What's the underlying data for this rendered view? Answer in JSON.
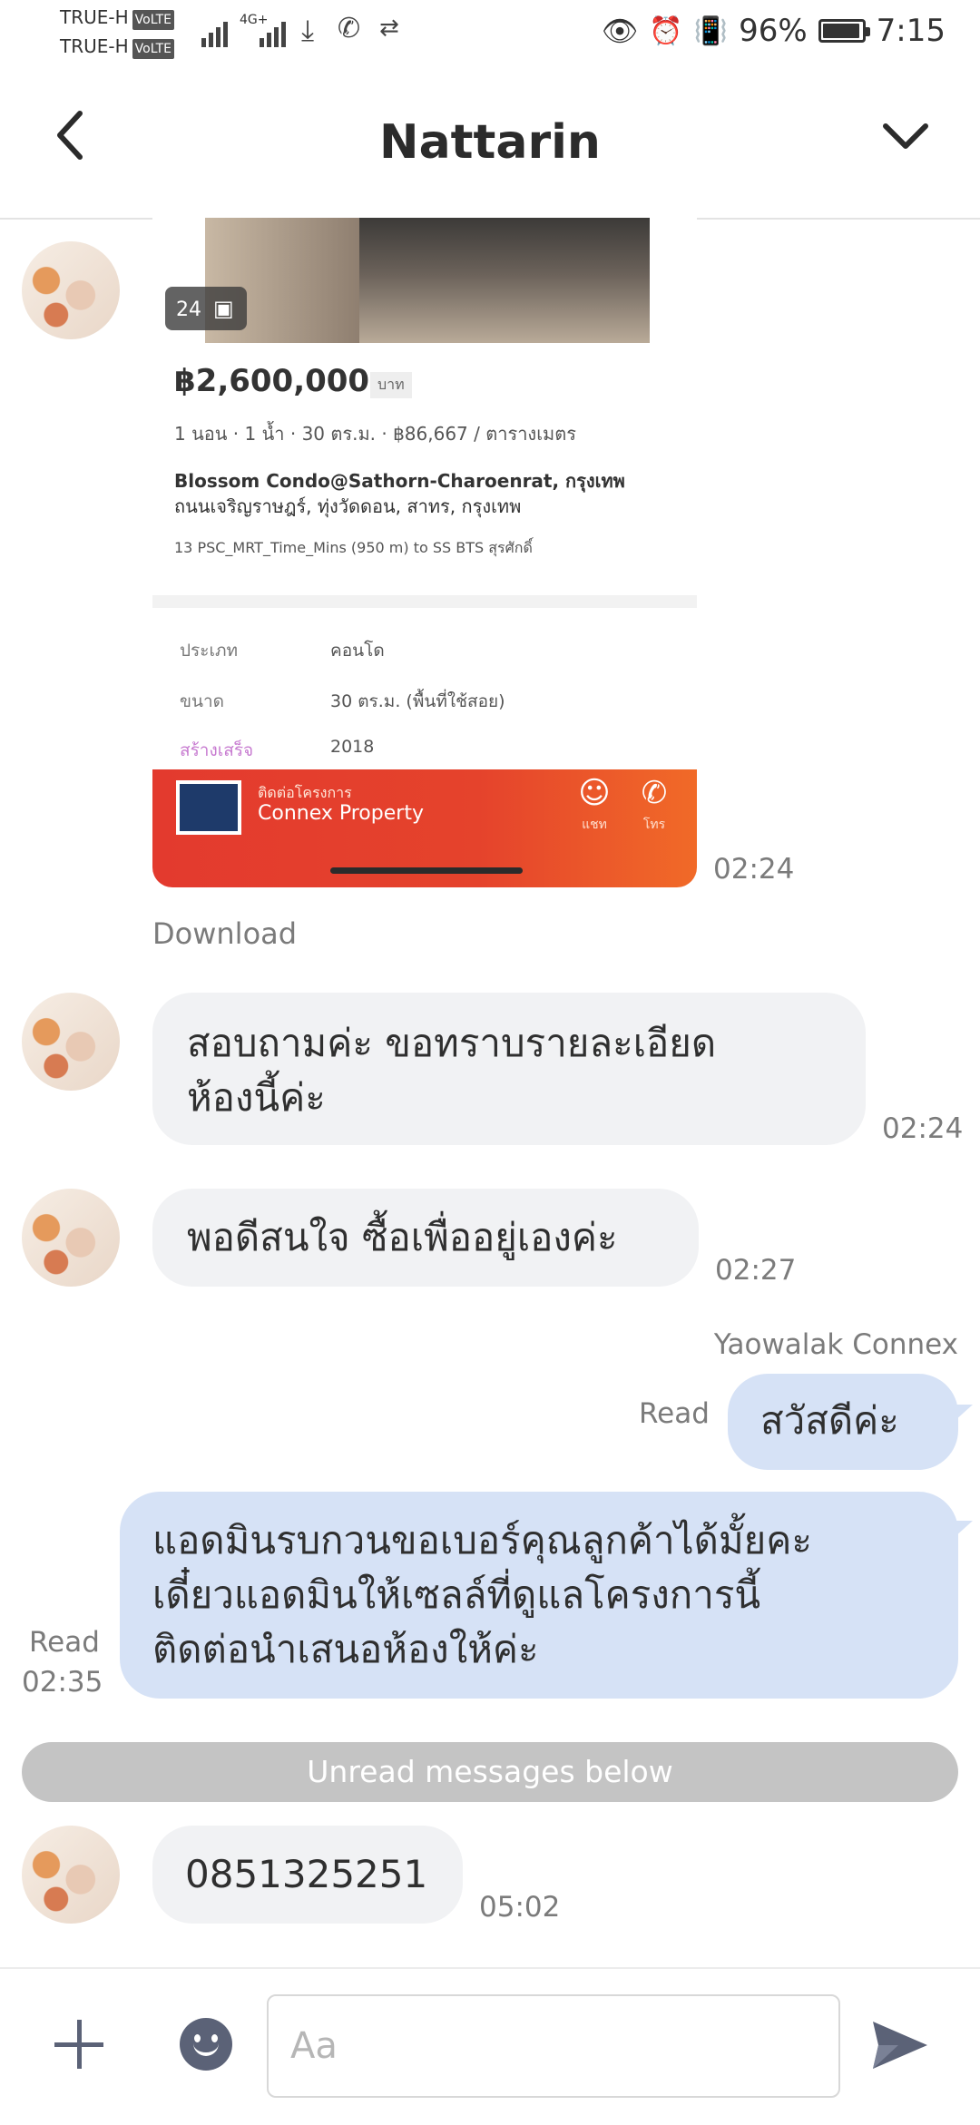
{
  "status_bar": {
    "carrier_1": "TRUE-H",
    "carrier_2": "TRUE-H",
    "volte": "VoLTE",
    "network": "4G+",
    "battery": "96%",
    "battery_level": 0.96,
    "time": "7:15"
  },
  "header": {
    "title": "Nattarin"
  },
  "card": {
    "photo_count": "24",
    "price": "฿2,600,000",
    "price_unit": "บาท",
    "specs": "1 นอน · 1 น้ำ · 30 ตร.ม. · ฿86,667 / ตารางเมตร",
    "address_1": "Blossom Condo@Sathorn-Charoenrat, กรุงเทพ",
    "address_2": "ถนนเจริญราษฎร์, ทุ่งวัดดอน, สาทร, กรุงเทพ",
    "transit": "13 PSC_MRT_Time_Mins (950 m) to SS BTS สุรศักดิ์",
    "details": [
      {
        "key": "ประเภท",
        "value": "คอนโด"
      },
      {
        "key": "ขนาด",
        "value": "30 ตร.ม. (พื้นที่ใช้สอย)"
      },
      {
        "key": "สร้างเสร็จ",
        "value": "2018"
      }
    ],
    "agent_label": "ติดต่อโครงการ",
    "agent_name": "Connex Property",
    "chat_label": "แชท",
    "call_label": "โทร"
  },
  "messages": {
    "image_time": "02:24",
    "download": "Download",
    "msg1_line1": "สอบถามค่ะ ขอทราบรายละเอียด",
    "msg1_line2": "ห้องนี้ค่ะ",
    "msg1_time": "02:24",
    "msg2": "พอดีสนใจ ซื้อเพื่ออยู่เองค่ะ",
    "msg2_time": "02:27",
    "sender": "Yaowalak Connex",
    "read_label": "Read",
    "msg3": "สวัสดีค่ะ",
    "msg4_line1": "แอดมินรบกวนขอเบอร์คุณลูกค้าได้มั้ยคะ",
    "msg4_line2": "เดี๋ยวแอดมินให้เซลล์ที่ดูแลโครงการนี้",
    "msg4_line3": "ติดต่อนำเสนอห้องให้ค่ะ",
    "msg4_time": "02:35",
    "unread_divider": "Unread messages below",
    "msg5": "0851325251",
    "msg5_time": "05:02"
  },
  "input_bar": {
    "placeholder": "Aa"
  },
  "icons": {
    "back": "chevron-left-icon",
    "menu": "chevron-down-icon",
    "add": "plus-icon",
    "emoji": "emoji-icon",
    "send": "send-icon"
  },
  "colors": {
    "incoming_bubble": "#f1f2f4",
    "outgoing_bubble": "#d6e2f6",
    "unread_divider": "#c4c4c4",
    "icon": "#5b6277",
    "card_bar": "#e5432c"
  }
}
